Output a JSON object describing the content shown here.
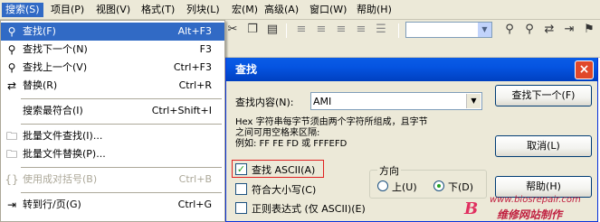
{
  "menubar": {
    "items": [
      {
        "label": "搜索(S)"
      },
      {
        "label": "项目(P)"
      },
      {
        "label": "视图(V)"
      },
      {
        "label": "格式(T)"
      },
      {
        "label": "列块(L)"
      },
      {
        "label": "宏(M)"
      },
      {
        "label": "高级(A)"
      },
      {
        "label": "窗口(W)"
      },
      {
        "label": "帮助(H)"
      }
    ]
  },
  "search_menu": {
    "items": [
      {
        "icon": "binoculars-icon",
        "label": "查找(F)",
        "shortcut": "Alt+F3"
      },
      {
        "icon": "find-next-icon",
        "label": "查找下一个(N)",
        "shortcut": "F3"
      },
      {
        "icon": "find-prev-icon",
        "label": "查找上一个(V)",
        "shortcut": "Ctrl+F3"
      },
      {
        "icon": "replace-icon",
        "label": "替换(R)",
        "shortcut": "Ctrl+R"
      },
      {
        "icon": "",
        "label": "搜索最符合(I)",
        "shortcut": "Ctrl+Shift+I"
      },
      {
        "icon": "folder-find-icon",
        "label": "批量文件查找(I)...",
        "shortcut": ""
      },
      {
        "icon": "folder-replace-icon",
        "label": "批量文件替换(P)...",
        "shortcut": ""
      },
      {
        "icon": "bracket-match-icon",
        "label": "使用成对括号(B)",
        "shortcut": "Ctrl+B"
      },
      {
        "icon": "goto-icon",
        "label": "转到行/页(G)",
        "shortcut": "Ctrl+G"
      }
    ]
  },
  "find_dialog": {
    "title": "查找",
    "find_label": "查找内容(N):",
    "find_value": "AMI",
    "hint_line1": "Hex 字符串每字节须由两个字符所组成，且字节",
    "hint_line2": "之间可用空格来区隔:",
    "hint_line3": "例如: FF FE FD 或 FFFEFD",
    "find_next_button": "查找下一个(F)",
    "cancel_button": "取消(L)",
    "help_button": "帮助(H)",
    "find_ascii_label": "查找 ASCII(A)",
    "find_ascii_checked": true,
    "match_case_label": "符合大小写(C)",
    "regex_label": "正则表达式 (仅 ASCII)(E)",
    "direction_label": "方向",
    "dir_up_label": "上(U)",
    "dir_down_label": "下(D)",
    "direction_selected": "下"
  },
  "watermark": {
    "logo": "B",
    "url": "www.biosrepair.com",
    "text": "维修网站制作"
  }
}
